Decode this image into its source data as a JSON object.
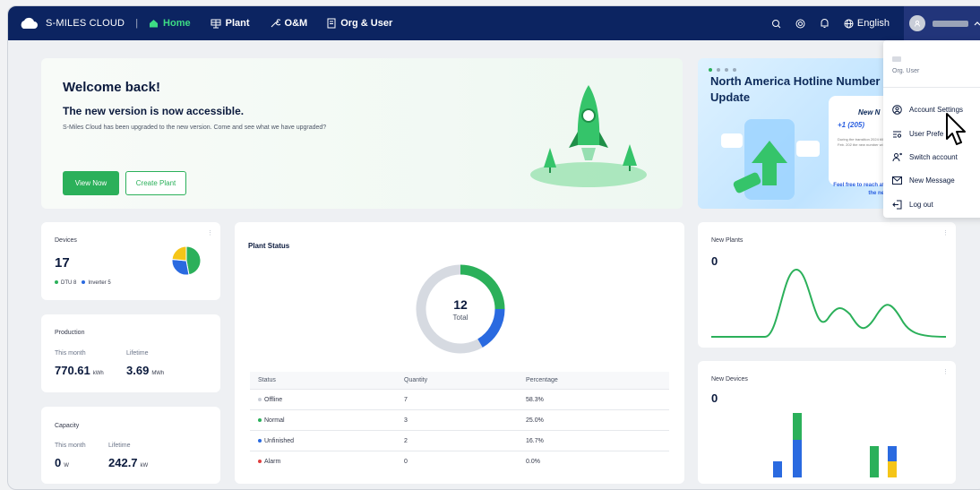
{
  "topbar": {
    "brand": "S-MILES CLOUD",
    "separator": "|",
    "nav": [
      {
        "label": "Home",
        "icon": "home-icon",
        "active": true
      },
      {
        "label": "Plant",
        "icon": "plant-icon",
        "active": false
      },
      {
        "label": "O&M",
        "icon": "wrench-icon",
        "active": false
      },
      {
        "label": "Org & User",
        "icon": "document-icon",
        "active": false
      }
    ],
    "language": "English"
  },
  "welcome": {
    "title": "Welcome back!",
    "subtitle": "The new version is now accessible.",
    "description": "S-Miles Cloud has been upgraded to the new version. Come and see what we have upgraded?",
    "view_now": "View Now",
    "create_plant": "Create Plant"
  },
  "banner": {
    "title": "North America Hotline Number Update",
    "card_title": "New N",
    "phone": "+1 (205)",
    "note": "During the transition 2024 till 15th Feb. 202 the new number wi",
    "feel_free": "Feel free to reach at the ne"
  },
  "devices": {
    "label": "Devices",
    "count": "17",
    "legend": [
      {
        "label": "DTU 8",
        "color": "#2bb05a"
      },
      {
        "label": "Inverter 5",
        "color": "#2a6ae0"
      }
    ],
    "pie": [
      {
        "name": "green",
        "value": 8,
        "color": "#2bb05a"
      },
      {
        "name": "blue",
        "value": 5,
        "color": "#2a6ae0"
      },
      {
        "name": "yellow",
        "value": 4,
        "color": "#f5c518"
      }
    ]
  },
  "production": {
    "label": "Production",
    "month_label": "This month",
    "lifetime_label": "Lifetime",
    "month_value": "770.61",
    "month_unit": "kWh",
    "lifetime_value": "3.69",
    "lifetime_unit": "MWh"
  },
  "capacity": {
    "label": "Capacity",
    "month_label": "This month",
    "lifetime_label": "Lifetime",
    "month_value": "0",
    "month_unit": "W",
    "lifetime_value": "242.7",
    "lifetime_unit": "kW"
  },
  "plant_status": {
    "title": "Plant Status",
    "total": "12",
    "total_label": "Total",
    "columns": [
      "Status",
      "Quantity",
      "Percentage"
    ],
    "rows": [
      {
        "status": "Offline",
        "quantity": "7",
        "percentage": "58.3%",
        "color": "#c9ced8"
      },
      {
        "status": "Normal",
        "quantity": "3",
        "percentage": "25.0%",
        "color": "#2bb05a"
      },
      {
        "status": "Unfinished",
        "quantity": "2",
        "percentage": "16.7%",
        "color": "#2a6ae0"
      },
      {
        "status": "Alarm",
        "quantity": "0",
        "percentage": "0.0%",
        "color": "#e04040"
      }
    ]
  },
  "new_plants": {
    "label": "New Plants",
    "value": "0"
  },
  "new_devices": {
    "label": "New Devices",
    "value": "0"
  },
  "user_menu": {
    "org": "Org. User",
    "items": [
      {
        "label": "Account Settings",
        "icon": "user-circle-icon"
      },
      {
        "label": "User Prefe",
        "icon": "preferences-icon"
      },
      {
        "label": "Switch account",
        "icon": "switch-user-icon"
      },
      {
        "label": "New Message",
        "icon": "mail-icon"
      },
      {
        "label": "Log out",
        "icon": "logout-icon"
      }
    ]
  },
  "colors": {
    "topbar": "#0c2461",
    "accent": "#2bb05a",
    "blue": "#2a6ae0",
    "yellow": "#f5c518"
  }
}
